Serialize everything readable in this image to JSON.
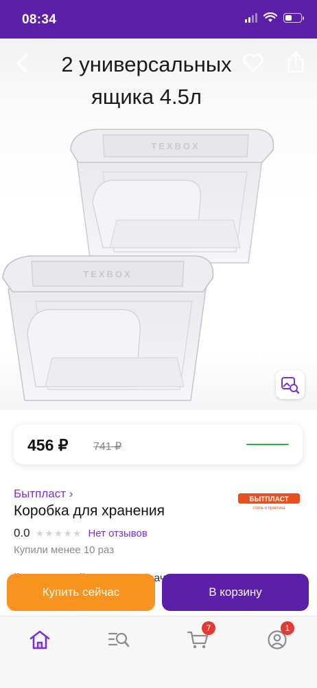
{
  "status_bar": {
    "time": "08:34"
  },
  "header": {
    "title": "2 универсальных ящика 4.5л"
  },
  "product_image": {
    "embossed_text": "TEXBOX"
  },
  "price": {
    "current": "456 ₽",
    "old": "741 ₽"
  },
  "brand": {
    "name": "Бытпласт",
    "logo_text": "БЫТПЛАСТ",
    "logo_tagline": "стиль и практика",
    "link_arrow": "›"
  },
  "product": {
    "name": "Коробка для хранения",
    "rating": "0.0",
    "rating_stars": 0,
    "reviews_label": "Нет отзывов",
    "purchases_label": "Купили менее 10 раз",
    "description_peek": "й я с крышкой. Через прозрачные стенки и крышку"
  },
  "actions": {
    "buy_now": "Купить сейчас",
    "add_to_cart": "В корзину"
  },
  "tab_bar": {
    "items": [
      {
        "name": "home",
        "icon": "home-icon",
        "active": true
      },
      {
        "name": "catalog",
        "icon": "catalog-search-icon",
        "active": false
      },
      {
        "name": "cart",
        "icon": "cart-icon",
        "badge": "7",
        "active": false
      },
      {
        "name": "profile",
        "icon": "profile-icon",
        "badge": "1",
        "active": false
      }
    ]
  },
  "colors": {
    "brand_purple": "#5b1fa8",
    "accent_purple": "#7a2ed6",
    "buy_now_orange": "#f7931e",
    "badge_red": "#e53935",
    "price_bar_green": "#2bb24c"
  }
}
